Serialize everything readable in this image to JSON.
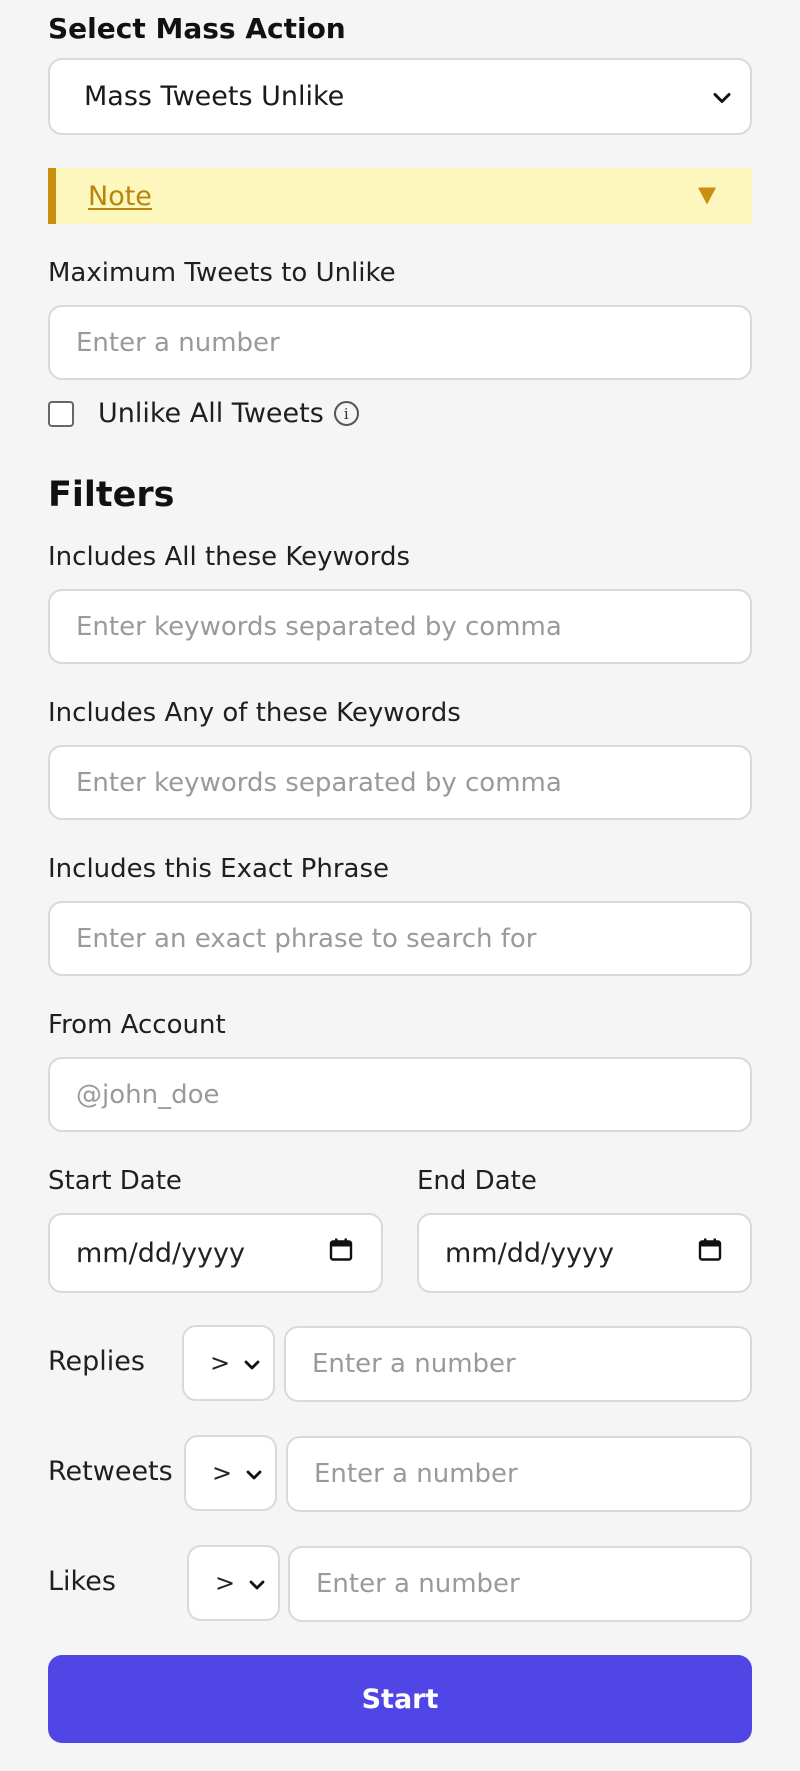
{
  "form": {
    "title": "Select Mass Action",
    "action_selected": "Mass Tweets Unlike",
    "note_label": "Note",
    "max_label": "Maximum Tweets to Unlike",
    "max_placeholder": "Enter a number",
    "unlike_all_label": "Unlike All Tweets",
    "info_glyph": "i"
  },
  "filters": {
    "heading": "Filters",
    "all_keywords": {
      "label": "Includes All these Keywords",
      "placeholder": "Enter keywords separated by comma"
    },
    "any_keywords": {
      "label": "Includes Any of these Keywords",
      "placeholder": "Enter keywords separated by comma"
    },
    "exact_phrase": {
      "label": "Includes this Exact Phrase",
      "placeholder": "Enter an exact phrase to search for"
    },
    "from_account": {
      "label": "From Account",
      "placeholder": "@john_doe"
    },
    "start_date": {
      "label": "Start Date",
      "placeholder": "mm/dd/yyyy"
    },
    "end_date": {
      "label": "End Date",
      "placeholder": "mm/dd/yyyy"
    },
    "replies": {
      "label": "Replies",
      "operator": ">",
      "placeholder": "Enter a number"
    },
    "retweets": {
      "label": "Retweets",
      "operator": ">",
      "placeholder": "Enter a number"
    },
    "likes": {
      "label": "Likes",
      "operator": ">",
      "placeholder": "Enter a number"
    }
  },
  "actions": {
    "start_label": "Start"
  },
  "colors": {
    "accent": "#4f46e5",
    "note_bg": "#fdf6bd",
    "note_border": "#c9900f"
  },
  "icons": [
    "chevron-down-icon",
    "triangle-down-icon",
    "info-icon",
    "calendar-icon"
  ]
}
